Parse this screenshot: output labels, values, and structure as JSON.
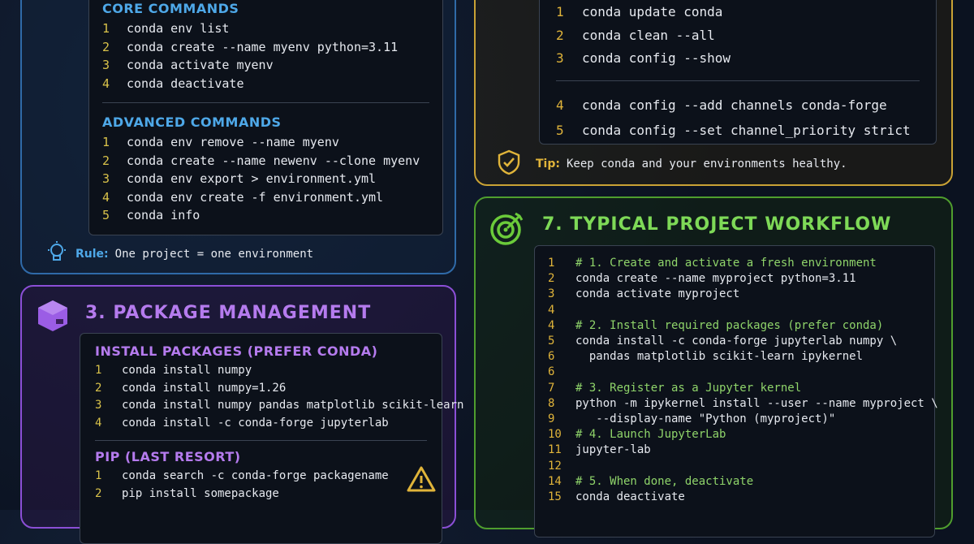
{
  "env_panel": {
    "core_title": "CORE COMMANDS",
    "core_lines": [
      {
        "n": "1",
        "t": "conda env list"
      },
      {
        "n": "2",
        "t": "conda create --name myenv python=3.11"
      },
      {
        "n": "3",
        "t": "conda activate myenv"
      },
      {
        "n": "4",
        "t": "conda deactivate"
      }
    ],
    "adv_title": "ADVANCED COMMANDS",
    "adv_lines": [
      {
        "n": "1",
        "t": "conda env remove --name myenv"
      },
      {
        "n": "2",
        "t": "conda create --name newenv --clone myenv"
      },
      {
        "n": "3",
        "t": "conda env export > environment.yml"
      },
      {
        "n": "4",
        "t": "conda env create -f environment.yml"
      },
      {
        "n": "5",
        "t": "conda info"
      }
    ],
    "rule_label": "Rule:",
    "rule_text": "One project = one environment"
  },
  "pkg_panel": {
    "title": "3. PACKAGE MANAGEMENT",
    "install_title": "INSTALL PACKAGES (PREFER CONDA)",
    "install_lines": [
      {
        "n": "1",
        "t": "conda install numpy"
      },
      {
        "n": "2",
        "t": "conda install numpy=1.26"
      },
      {
        "n": "3",
        "t": "conda install numpy pandas matplotlib scikit-learn"
      },
      {
        "n": "4",
        "t": "conda install -c conda-forge jupyterlab"
      }
    ],
    "pip_title": "PIP (LAST RESORT)",
    "pip_lines": [
      {
        "n": "1",
        "t": "conda search -c conda-forge packagename"
      },
      {
        "n": "2",
        "t": "pip install somepackage"
      }
    ]
  },
  "maint_panel": {
    "lines_a": [
      {
        "n": "1",
        "t": "conda update conda"
      },
      {
        "n": "2",
        "t": "conda clean --all"
      },
      {
        "n": "3",
        "t": "conda config --show"
      }
    ],
    "lines_b": [
      {
        "n": "4",
        "t": "conda config --add channels conda-forge"
      },
      {
        "n": "5",
        "t": "conda config --set channel_priority strict"
      }
    ],
    "tip_label": "Tip:",
    "tip_text": "Keep conda and your environments healthy."
  },
  "workflow_panel": {
    "title": "7. TYPICAL PROJECT WORKFLOW",
    "lines": [
      {
        "n": "1",
        "t": "# 1. Create and activate a fresh environment",
        "c": true
      },
      {
        "n": "2",
        "t": "conda create --name myproject python=3.11"
      },
      {
        "n": "3",
        "t": "conda activate myproject"
      },
      {
        "n": "4",
        "t": ""
      },
      {
        "n": "4",
        "t": "# 2. Install required packages (prefer conda)",
        "c": true
      },
      {
        "n": "5",
        "t": "conda install -c conda-forge jupyterlab numpy \\"
      },
      {
        "n": "6",
        "t": "  pandas matplotlib scikit-learn ipykernel"
      },
      {
        "n": "6",
        "t": ""
      },
      {
        "n": "7",
        "t": "# 3. Register as a Jupyter kernel",
        "c": true
      },
      {
        "n": "8",
        "t": "python -m ipykernel install --user --name myproject \\"
      },
      {
        "n": "9",
        "t": "   --display-name \"Python (myproject)\""
      },
      {
        "n": "10",
        "t": "# 4. Launch JupyterLab",
        "c": true
      },
      {
        "n": "11",
        "t": "jupyter-lab"
      },
      {
        "n": "12",
        "t": ""
      },
      {
        "n": "14",
        "t": "# 5. When done, deactivate",
        "c": true
      },
      {
        "n": "15",
        "t": "conda deactivate"
      }
    ]
  },
  "colors": {
    "blue": "#3b82c4",
    "blue_title": "#4ea8e8",
    "purple": "#9b5de5",
    "purple_title": "#b57bee",
    "yellow": "#e0b43a",
    "green": "#6bcb3a",
    "green_title": "#7ed957",
    "line_num_blue": "#d9c24a",
    "comment": "#8fd46a"
  }
}
